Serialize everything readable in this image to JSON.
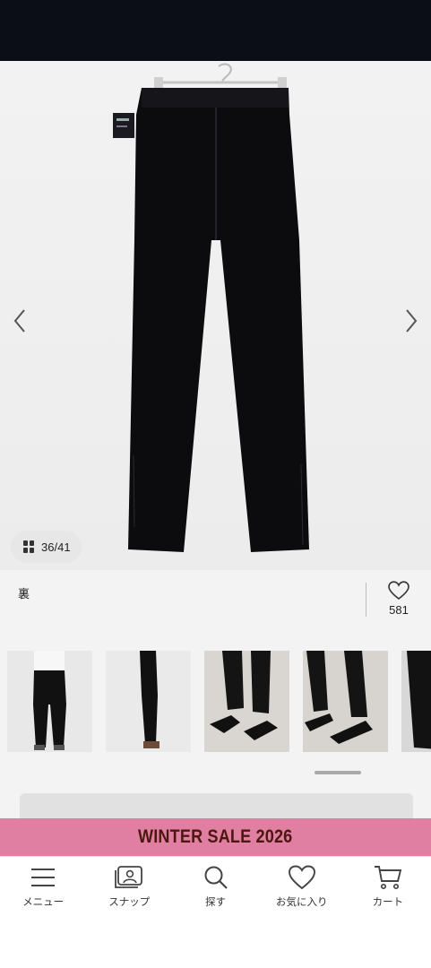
{
  "gallery": {
    "counter_current": "36",
    "counter_total": "41",
    "caption": "裏",
    "favorite_count": "581"
  },
  "thumbnails": [
    {
      "name": "thumbnail-model-back"
    },
    {
      "name": "thumbnail-model-side"
    },
    {
      "name": "thumbnail-shoes-front"
    },
    {
      "name": "thumbnail-shoes-angle"
    },
    {
      "name": "thumbnail-partial"
    }
  ],
  "banner": {
    "text": "WINTER SALE 2026",
    "background": "#e07fa1",
    "text_color": "#4b1810"
  },
  "bottom_nav": {
    "items": [
      {
        "label": "メニュー",
        "icon": "menu-icon"
      },
      {
        "label": "スナップ",
        "icon": "snap-icon"
      },
      {
        "label": "探す",
        "icon": "search-icon"
      },
      {
        "label": "お気に入り",
        "icon": "heart-icon"
      },
      {
        "label": "カート",
        "icon": "cart-icon"
      }
    ]
  }
}
